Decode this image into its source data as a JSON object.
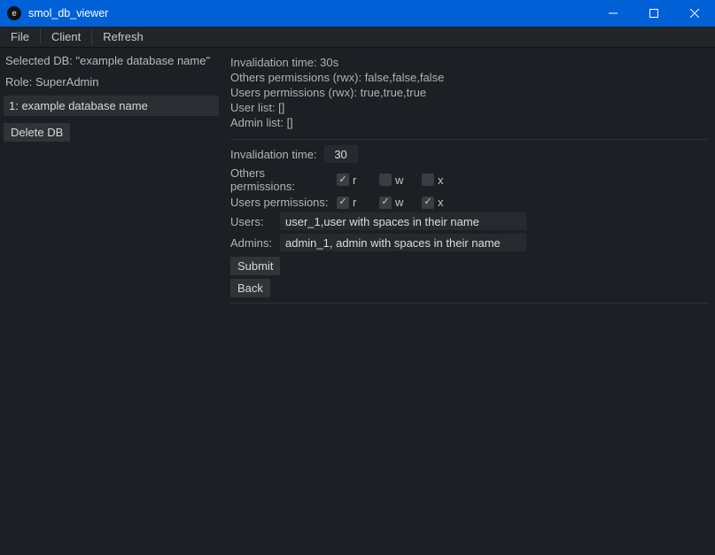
{
  "window": {
    "title": "smol_db_viewer",
    "app_icon_letter": "e"
  },
  "menubar": {
    "items": [
      "File",
      "Client",
      "Refresh"
    ]
  },
  "sidebar": {
    "selected_label": "Selected DB: \"example database name\"",
    "role_label": "Role: SuperAdmin",
    "db_items": [
      "1: example database name"
    ],
    "delete_label": "Delete DB"
  },
  "details": {
    "lines": [
      "Invalidation time: 30s",
      "Others permissions (rwx): false,false,false",
      "Users permissions (rwx): true,true,true",
      "User list: []",
      "Admin list: []"
    ]
  },
  "form": {
    "invalidation_label": "Invalidation time:",
    "invalidation_value": "30",
    "others_label": "Others permissions:",
    "users_label": "Users permissions:",
    "perm_labels": {
      "r": "r",
      "w": "w",
      "x": "x"
    },
    "others": {
      "r": true,
      "w": false,
      "x": false
    },
    "users": {
      "r": true,
      "w": true,
      "x": true
    },
    "users_field_label": "Users:",
    "users_field_value": "user_1,user with spaces in their name",
    "admins_field_label": "Admins:",
    "admins_field_value": "admin_1, admin with spaces in their name",
    "submit_label": "Submit",
    "back_label": "Back"
  }
}
